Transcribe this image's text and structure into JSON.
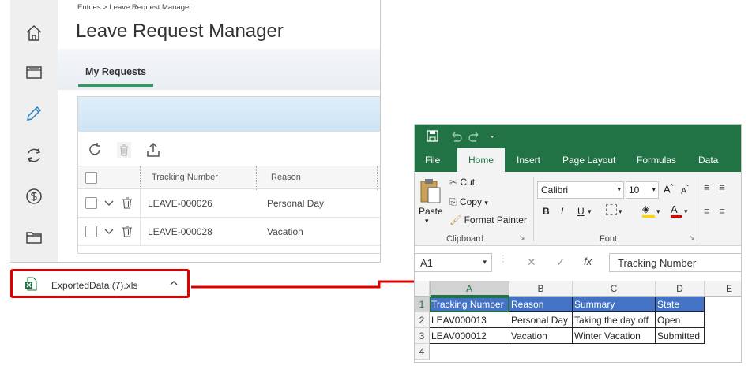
{
  "app": {
    "breadcrumb": "Entries > Leave Request Manager",
    "title": "Leave Request Manager",
    "tab": "My Requests",
    "columns": {
      "tracking": "Tracking Number",
      "reason": "Reason"
    },
    "rows": [
      {
        "tracking": "LEAVE-000026",
        "reason": "Personal Day"
      },
      {
        "tracking": "LEAVE-000028",
        "reason": "Vacation"
      }
    ],
    "sidebar_icons": [
      "home-icon",
      "inbox-icon",
      "pencil-icon",
      "sync-icon",
      "dollar-icon",
      "folder-icon"
    ]
  },
  "download": {
    "filename": "ExportedData (7).xls"
  },
  "excel": {
    "tabs": [
      "File",
      "Home",
      "Insert",
      "Page Layout",
      "Formulas",
      "Data"
    ],
    "active_tab": "Home",
    "clipboard": {
      "paste": "Paste",
      "cut": "Cut",
      "copy": "Copy",
      "format_painter": "Format Painter",
      "label": "Clipboard"
    },
    "font": {
      "name": "Calibri",
      "size": "10",
      "label": "Font",
      "bold": "B",
      "italic": "I",
      "underline": "U"
    },
    "name_box": "A1",
    "formula": "Tracking Number",
    "col_headers": [
      "A",
      "B",
      "C",
      "D",
      "E"
    ],
    "row_headers": [
      "1",
      "2",
      "3",
      "4"
    ],
    "cells": [
      [
        "Tracking Number",
        "Reason",
        "Summary",
        "State"
      ],
      [
        "LEAV000013",
        "Personal Day",
        "Taking the day off",
        "Open"
      ],
      [
        "LEAV000012",
        "Vacation",
        "Winter Vacation",
        "Submitted"
      ]
    ]
  },
  "colors": {
    "excel_green": "#217346",
    "header_blue": "#4472c4",
    "highlight_red": "#e00000",
    "tab_green": "#2e9a5e"
  }
}
